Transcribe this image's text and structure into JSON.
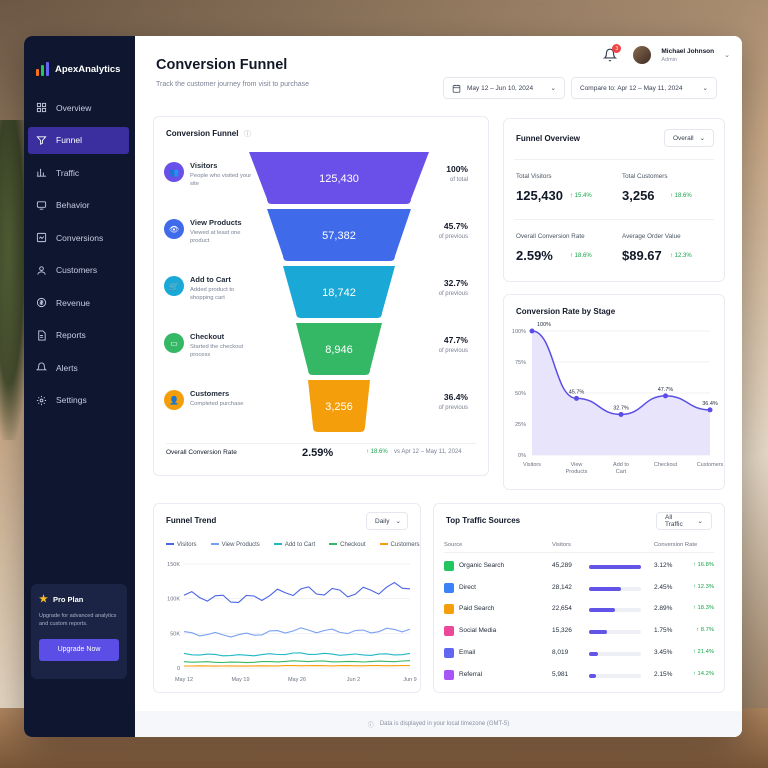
{
  "app": {
    "name": "ApexAnalytics"
  },
  "sidebar": {
    "items": [
      {
        "label": "Overview",
        "icon": "overview-icon"
      },
      {
        "label": "Funnel",
        "icon": "funnel-icon",
        "active": true
      },
      {
        "label": "Traffic",
        "icon": "traffic-icon"
      },
      {
        "label": "Behavior",
        "icon": "behavior-icon"
      },
      {
        "label": "Conversions",
        "icon": "conversions-icon"
      },
      {
        "label": "Customers",
        "icon": "customers-icon"
      },
      {
        "label": "Revenue",
        "icon": "revenue-icon"
      },
      {
        "label": "Reports",
        "icon": "reports-icon"
      },
      {
        "label": "Alerts",
        "icon": "alerts-icon"
      },
      {
        "label": "Settings",
        "icon": "settings-icon"
      }
    ],
    "pro": {
      "title": "Pro Plan",
      "desc": "Upgrade for advanced analytics and custom reports.",
      "button": "Upgrade Now"
    }
  },
  "header": {
    "title": "Conversion Funnel",
    "subtitle": "Track the customer journey from visit to purchase",
    "notifications": "3",
    "user_name": "Michael Johnson",
    "user_role": "Admin",
    "date_range": "May 12 – Jun 10, 2024",
    "compare": "Compare to: Apr 12 – May 11, 2024"
  },
  "funnel": {
    "title": "Conversion Funnel",
    "stages": [
      {
        "name": "Visitors",
        "desc": "People who visited your site",
        "value": "125,430",
        "pct": "100%",
        "pct_label": "of total",
        "color": "#6a4fe8"
      },
      {
        "name": "View Products",
        "desc": "Viewed at least one product",
        "value": "57,382",
        "pct": "45.7%",
        "pct_label": "of previous",
        "color": "#3f6bea"
      },
      {
        "name": "Add to Cart",
        "desc": "Added product to shopping cart",
        "value": "18,742",
        "pct": "32.7%",
        "pct_label": "of previous",
        "color": "#1aa9d6"
      },
      {
        "name": "Checkout",
        "desc": "Started the checkout process",
        "value": "8,946",
        "pct": "47.7%",
        "pct_label": "of previous",
        "color": "#34b865"
      },
      {
        "name": "Customers",
        "desc": "Completed purchase",
        "value": "3,256",
        "pct": "36.4%",
        "pct_label": "of previous",
        "color": "#f59e0b"
      }
    ],
    "overall_label": "Overall Conversion Rate",
    "overall_value": "2.59%",
    "overall_change": "↑ 18.6%",
    "overall_vs": "vs Apr 12 – May 11, 2024"
  },
  "overview": {
    "title": "Funnel Overview",
    "filter": "Overall",
    "kpis": [
      {
        "label": "Total Visitors",
        "value": "125,430",
        "change": "↑ 15.4%"
      },
      {
        "label": "Total Customers",
        "value": "3,256",
        "change": "↑ 18.6%"
      },
      {
        "label": "Overall Conversion Rate",
        "value": "2.59%",
        "change": "↑ 18.6%"
      },
      {
        "label": "Average Order Value",
        "value": "$89.67",
        "change": "↑ 12.3%"
      }
    ]
  },
  "rate_chart": {
    "title": "Conversion Rate by Stage",
    "y_ticks": [
      "100%",
      "75%",
      "50%",
      "25%",
      "0%"
    ],
    "x_labels": [
      [
        "Visitors"
      ],
      [
        "View",
        "Products"
      ],
      [
        "Add to",
        "Cart"
      ],
      [
        "Checkout"
      ],
      [
        "Customers"
      ]
    ],
    "point_labels": [
      "100%",
      "45.7%",
      "32.7%",
      "47.7%",
      "36.4%"
    ]
  },
  "trend": {
    "title": "Funnel Trend",
    "filter": "Daily",
    "legend": [
      "Visitors",
      "View Products",
      "Add to Cart",
      "Checkout",
      "Customers"
    ],
    "colors": [
      "#4b63e6",
      "#7aa0f2",
      "#20b7c6",
      "#34b865",
      "#f59e0b"
    ],
    "y_ticks": [
      "150K",
      "100K",
      "50K",
      "0"
    ],
    "x_ticks": [
      "May 12",
      "May 19",
      "May 26",
      "Jun 2",
      "Jun 9"
    ]
  },
  "sources": {
    "title": "Top Traffic Sources",
    "filter": "All Traffic",
    "headers": [
      "Source",
      "Visitors",
      "Conversion Rate"
    ],
    "rows": [
      {
        "name": "Organic Search",
        "visitors": "45,289",
        "rate": "3.12%",
        "change": "↑ 16.8%",
        "share": 1.0,
        "color": "#22c55e"
      },
      {
        "name": "Direct",
        "visitors": "28,142",
        "rate": "2.45%",
        "change": "↑ 12.3%",
        "share": 0.62,
        "color": "#3b82f6"
      },
      {
        "name": "Paid Search",
        "visitors": "22,654",
        "rate": "2.89%",
        "change": "↑ 18.3%",
        "share": 0.5,
        "color": "#f59e0b"
      },
      {
        "name": "Social Media",
        "visitors": "15,326",
        "rate": "1.75%",
        "change": "↑ 8.7%",
        "share": 0.34,
        "color": "#ec4899"
      },
      {
        "name": "Email",
        "visitors": "8,019",
        "rate": "3.45%",
        "change": "↑ 21.4%",
        "share": 0.18,
        "color": "#6366f1"
      },
      {
        "name": "Referral",
        "visitors": "5,981",
        "rate": "2.15%",
        "change": "↑ 14.2%",
        "share": 0.13,
        "color": "#a855f7"
      }
    ]
  },
  "footer": {
    "note": "Data is displayed in your local timezone (GMT-5)"
  },
  "chart_data": [
    {
      "type": "line",
      "title": "Conversion Rate by Stage",
      "categories": [
        "Visitors",
        "View Products",
        "Add to Cart",
        "Checkout",
        "Customers"
      ],
      "values": [
        100,
        45.7,
        32.7,
        47.7,
        36.4
      ],
      "ylim": [
        0,
        100
      ],
      "ylabel": "",
      "xlabel": ""
    },
    {
      "type": "line",
      "title": "Funnel Trend",
      "x": [
        "May 12",
        "May 19",
        "May 26",
        "Jun 2",
        "Jun 9"
      ],
      "ylim": [
        0,
        150000
      ],
      "series": [
        {
          "name": "Visitors",
          "values": [
            105000,
            98000,
            112000,
            108000,
            120000
          ]
        },
        {
          "name": "View Products",
          "values": [
            50000,
            47000,
            55000,
            52000,
            56000
          ]
        },
        {
          "name": "Add to Cart",
          "values": [
            20000,
            18000,
            21000,
            19000,
            20000
          ]
        },
        {
          "name": "Checkout",
          "values": [
            9000,
            8000,
            10000,
            9000,
            10000
          ]
        },
        {
          "name": "Customers",
          "values": [
            3000,
            2800,
            3400,
            3200,
            3500
          ]
        }
      ]
    }
  ]
}
